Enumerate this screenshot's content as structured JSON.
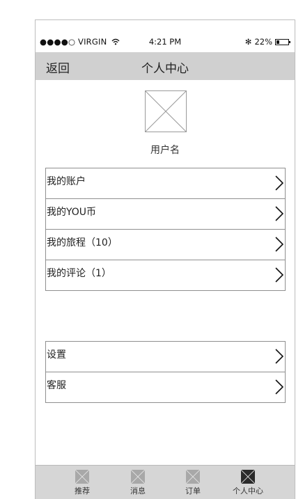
{
  "status_bar": {
    "carrier": "●●●●○ VIRGIN",
    "time": "4:21 PM",
    "bluetooth": "✻",
    "battery_text": "22%",
    "battery_level": 0.22
  },
  "navbar": {
    "back_label": "返回",
    "title": "个人中心"
  },
  "profile": {
    "username": "用户名"
  },
  "menu_primary": [
    {
      "label": "我的账户"
    },
    {
      "label": "我的YOU币"
    },
    {
      "label": "我的旅程（10）"
    },
    {
      "label": "我的评论（1）"
    }
  ],
  "menu_secondary": [
    {
      "label": "设置"
    },
    {
      "label": "客服"
    }
  ],
  "tabbar": {
    "tabs": [
      {
        "label": "推荐",
        "active": false
      },
      {
        "label": "消息",
        "active": false
      },
      {
        "label": "订单",
        "active": false
      },
      {
        "label": "个人中心",
        "active": true
      }
    ]
  },
  "colors": {
    "navbar_bg": "#d0d0d0",
    "tabbar_bg": "#d6d6d6",
    "tab_icon_inactive": "#a8a8a8",
    "tab_icon_active": "#2a2a2a"
  }
}
